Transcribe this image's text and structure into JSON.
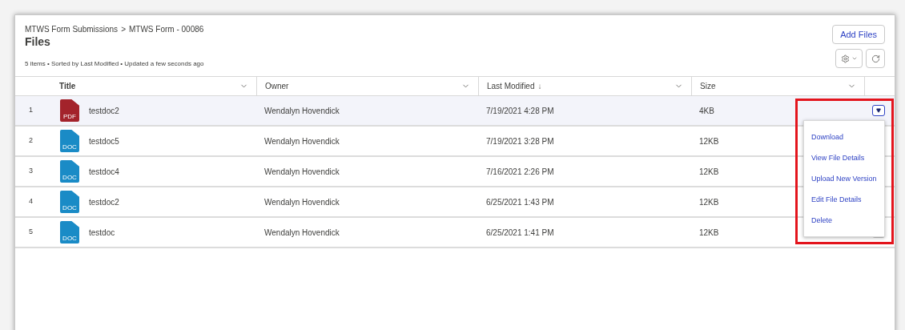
{
  "breadcrumb": {
    "parent": "MTWS Form Submissions",
    "separator": ">",
    "current": "MTWS Form - 00086"
  },
  "title": "Files",
  "summary": "5 items • Sorted by Last Modified • Updated a few seconds ago",
  "actions": {
    "add_button": "Add Files"
  },
  "table": {
    "columns": [
      {
        "label": "Title"
      },
      {
        "label": "Owner"
      },
      {
        "label": "Last Modified",
        "sort_indicator": "↓"
      },
      {
        "label": "Size"
      }
    ],
    "rows": [
      {
        "number": "1",
        "file_type": "PDF",
        "title": "testdoc2",
        "owner": "Wendalyn Hovendick",
        "modified": "7/19/2021 4:28 PM",
        "size": "4KB",
        "selected": true
      },
      {
        "number": "2",
        "file_type": "DOC",
        "title": "testdoc5",
        "owner": "Wendalyn Hovendick",
        "modified": "7/19/2021 3:28 PM",
        "size": "12KB",
        "selected": false
      },
      {
        "number": "3",
        "file_type": "DOC",
        "title": "testdoc4",
        "owner": "Wendalyn Hovendick",
        "modified": "7/16/2021 2:26 PM",
        "size": "12KB",
        "selected": false
      },
      {
        "number": "4",
        "file_type": "DOC",
        "title": "testdoc2",
        "owner": "Wendalyn Hovendick",
        "modified": "6/25/2021 1:43 PM",
        "size": "12KB",
        "selected": false
      },
      {
        "number": "5",
        "file_type": "DOC",
        "title": "testdoc",
        "owner": "Wendalyn Hovendick",
        "modified": "6/25/2021 1:41 PM",
        "size": "12KB",
        "selected": false
      }
    ]
  },
  "row_menu": {
    "open": true,
    "items": [
      "Download",
      "View File Details",
      "Upload New Version",
      "Edit File Details",
      "Delete"
    ]
  },
  "highlight": true
}
